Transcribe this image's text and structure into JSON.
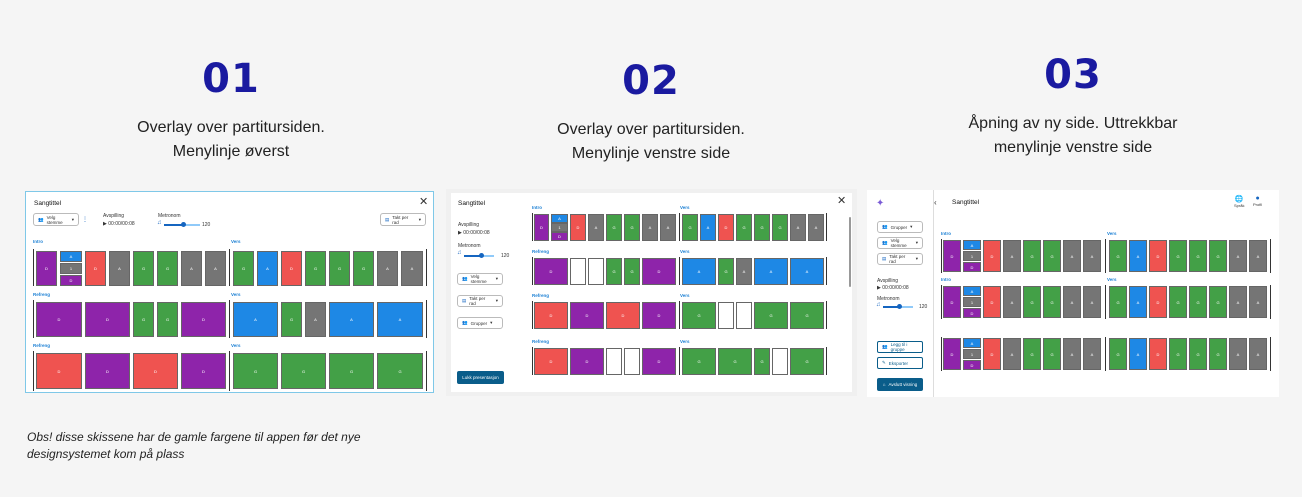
{
  "columns": [
    {
      "number": "01",
      "line1": "Overlay over partitursiden.",
      "line2": "Menylinje øverst"
    },
    {
      "number": "02",
      "line1": "Overlay over partitursiden.",
      "line2": "Menylinje venstre side"
    },
    {
      "number": "03",
      "line1": "Åpning av ny side. Uttrekkbar",
      "line2": "menylinje venstre side"
    }
  ],
  "note": {
    "line1": "Obs! disse skissene har de gamle fargene til appen før det nye",
    "line2": "designsystemet kom på plass"
  },
  "mockups": {
    "song_title": "Sangtittel",
    "playback_label": "Avspilling",
    "playback_time": "00:00/00:08",
    "metronome_label": "Metronom",
    "metronome_value": "120",
    "choose_voice": "Velg stemme",
    "beats_per_line": "Takt per rad",
    "groups": "Grupper",
    "close_presentation": "Lukk presentasjon",
    "add_to_group": "Legg til i gruppe",
    "edit": "Eksporter",
    "end_presentation": "Avslutt visning",
    "language": "Språk",
    "profile": "Profil",
    "sections": {
      "intro": "Intro",
      "verse": "Vers",
      "chorus": "Refreng"
    }
  },
  "colors": {
    "heading": "#1a1aa0",
    "purple": "#8e24aa",
    "red": "#ef5350",
    "green": "#43a047",
    "blue": "#1e88e5",
    "gray": "#757575",
    "primary_button": "#0a5d8a"
  }
}
